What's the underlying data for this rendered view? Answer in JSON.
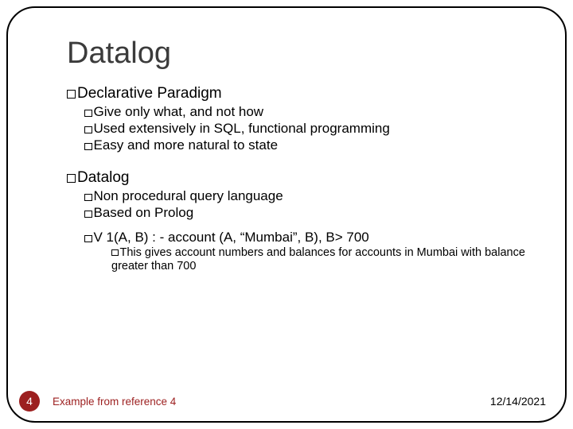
{
  "title": "Datalog",
  "sections": {
    "declarative": {
      "heading": "Declarative Paradigm",
      "items": [
        "Give  only what, and not how",
        "Used extensively in SQL, functional programming",
        "Easy and more natural to state"
      ]
    },
    "datalog": {
      "heading": "Datalog",
      "items": [
        "Non procedural query language",
        "Based on Prolog"
      ],
      "example": "V 1(A, B) : - account (A, “Mumbai”, B), B> 700",
      "example_note": "This gives account numbers and balances for accounts in Mumbai with balance greater than 700"
    }
  },
  "footer": {
    "page": "4",
    "reference": "Example from reference 4",
    "date": "12/14/2021"
  }
}
